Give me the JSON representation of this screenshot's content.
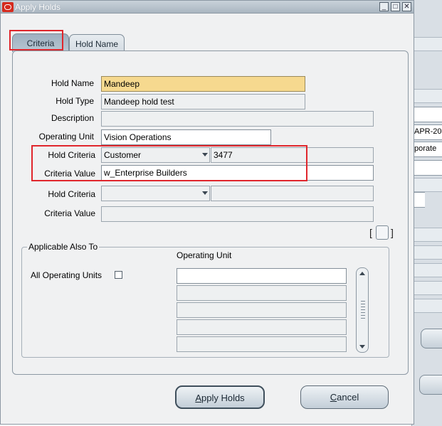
{
  "window": {
    "title": "Apply Holds"
  },
  "titlebar_buttons": {
    "minimize": "_",
    "maximize": "□",
    "close": "✕"
  },
  "tabs": [
    {
      "label": "Criteria",
      "active": true
    },
    {
      "label": "Hold Name",
      "active": false
    }
  ],
  "form": {
    "hold_name": {
      "label": "Hold Name",
      "value": "Mandeep"
    },
    "hold_type": {
      "label": "Hold Type",
      "value": "Mandeep hold test"
    },
    "description": {
      "label": "Description",
      "value": ""
    },
    "operating_unit": {
      "label": "Operating Unit",
      "value": "Vision Operations"
    },
    "criteria_1": {
      "hold_criteria_label": "Hold Criteria",
      "hold_criteria_value": "Customer",
      "hold_criteria_id": "3477",
      "criteria_value_label": "Criteria Value",
      "criteria_value": "w_Enterprise Builders"
    },
    "criteria_2": {
      "hold_criteria_label": "Hold Criteria",
      "hold_criteria_value": "",
      "hold_criteria_id": "",
      "criteria_value_label": "Criteria Value",
      "criteria_value": ""
    },
    "descriptive_flex": {
      "open": "[",
      "close": "]"
    }
  },
  "applicable": {
    "group_title": "Applicable Also To",
    "all_ou_label": "All Operating Units",
    "all_ou_checked": false,
    "ou_header": "Operating Unit",
    "ou_rows": [
      "",
      "",
      "",
      "",
      ""
    ]
  },
  "buttons": {
    "apply": {
      "label": "Apply Holds",
      "mnemonic": "A",
      "rest": "pply Holds"
    },
    "cancel": {
      "label": "Cancel",
      "mnemonic": "C",
      "rest": "ancel"
    }
  },
  "background_window": {
    "fragments": [
      "APR-20",
      "porate"
    ]
  },
  "colors": {
    "required_field": "#f6d98f",
    "highlight_box": "#e0262c",
    "active_tab": "#9eb0c0"
  }
}
